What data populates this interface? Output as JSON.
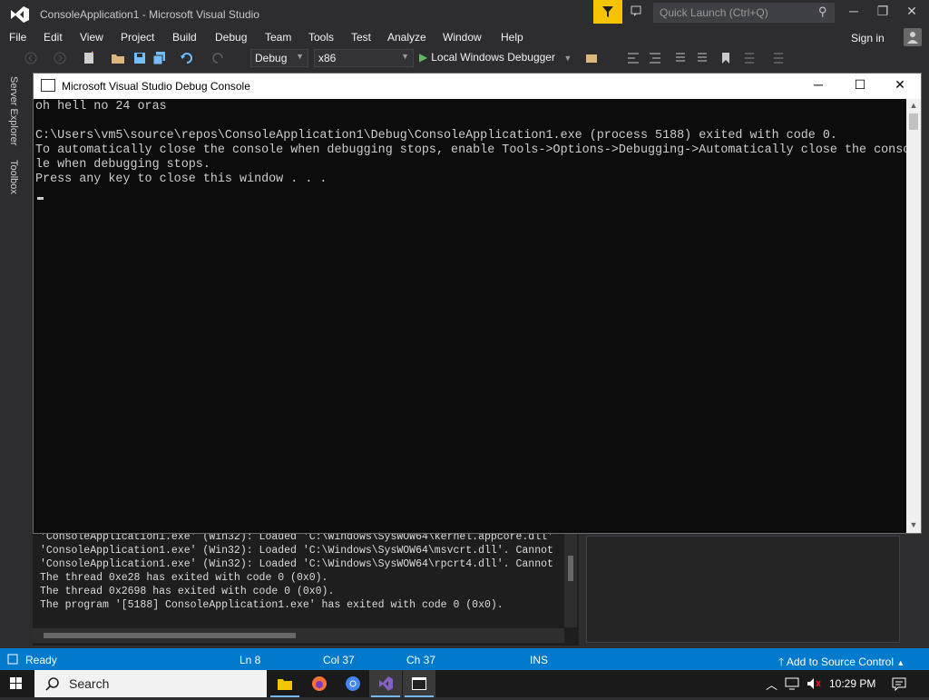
{
  "titlebar": {
    "title": "ConsoleApplication1 - Microsoft Visual Studio",
    "quick_launch_placeholder": "Quick Launch (Ctrl+Q)"
  },
  "menu": {
    "items": [
      "File",
      "Edit",
      "View",
      "Project",
      "Build",
      "Debug",
      "Team",
      "Tools",
      "Test",
      "Analyze",
      "Window",
      "Help"
    ],
    "sign_in": "Sign in"
  },
  "toolbar": {
    "configuration": "Debug",
    "platform": "x86",
    "run_label": "Local Windows Debugger"
  },
  "sidebar": {
    "tabs": [
      "Server Explorer",
      "Toolbox"
    ]
  },
  "console": {
    "title": "Microsoft Visual Studio Debug Console",
    "lines": [
      "oh hell no 24 oras",
      "",
      "C:\\Users\\vm5\\source\\repos\\ConsoleApplication1\\Debug\\ConsoleApplication1.exe (process 5188) exited with code 0.",
      "To automatically close the console when debugging stops, enable Tools->Options->Debugging->Automatically close the conso",
      "le when debugging stops.",
      "Press any key to close this window . . ."
    ]
  },
  "output": {
    "lines": [
      "'ConsoleApplication1.exe' (Win32): Loaded 'C:\\Windows\\SysWOW64\\kernel.appcore.dll'",
      "'ConsoleApplication1.exe' (Win32): Loaded 'C:\\Windows\\SysWOW64\\msvcrt.dll'. Cannot",
      "'ConsoleApplication1.exe' (Win32): Loaded 'C:\\Windows\\SysWOW64\\rpcrt4.dll'. Cannot",
      "The thread 0xe28 has exited with code 0 (0x0).",
      "The thread 0x2698 has exited with code 0 (0x0).",
      "The program '[5188] ConsoleApplication1.exe' has exited with code 0 (0x0)."
    ]
  },
  "statusbar": {
    "ready": "Ready",
    "ln": "Ln 8",
    "col": "Col 37",
    "ch": "Ch 37",
    "ins": "INS",
    "source_control": "Add to Source Control"
  },
  "taskbar": {
    "search": "Search",
    "clock": "10:29 PM",
    "apps": [
      "file-explorer-icon",
      "firefox-icon",
      "chrome-icon",
      "visual-studio-icon",
      "console-window-icon"
    ]
  },
  "colors": {
    "accent": "#007acc",
    "filter_highlight": "#f5c400",
    "ide_background": "#2d2d30"
  }
}
